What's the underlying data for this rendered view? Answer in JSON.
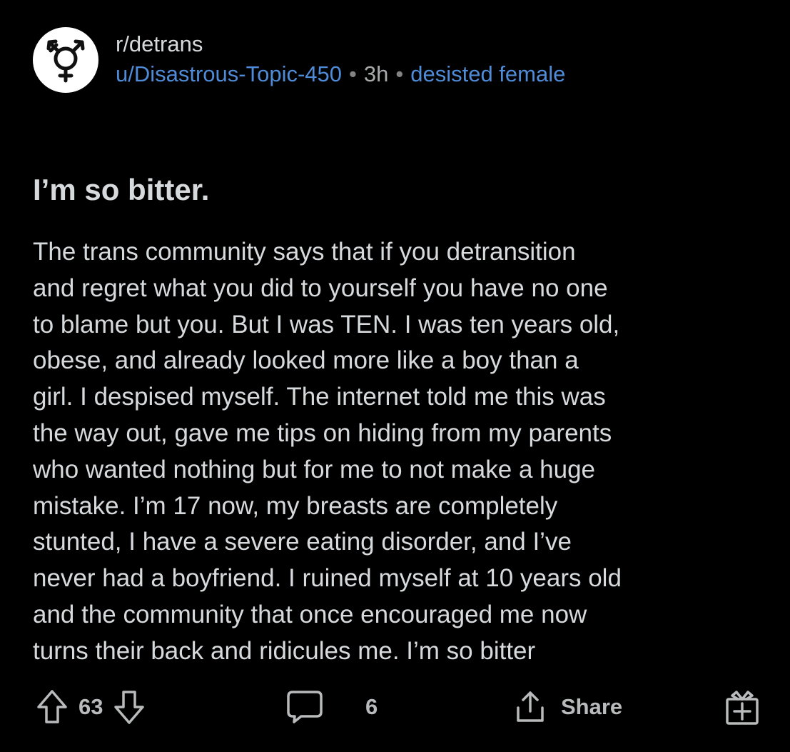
{
  "header": {
    "subreddit": "r/detrans",
    "username": "u/Disastrous-Topic-450",
    "separator": "•",
    "time": "3h",
    "flair": "desisted female",
    "avatar_icon": "transgender-symbol-icon"
  },
  "post": {
    "title": "I’m so bitter.",
    "body": "The trans community says that if you detransition\nand regret what you did to yourself you have no one\nto blame but you. But I was TEN. I was ten years old,\nobese, and already looked more like a boy than a\ngirl. I despised myself. The internet told me this was\nthe way out, gave me tips on hiding from my parents\nwho wanted nothing but for me to not make a huge\nmistake. I’m 17 now, my breasts are completely\nstunted, I have a severe eating disorder, and I’ve\nnever had a boyfriend. I ruined myself at 10 years old\nand the community that once encouraged me now\nturns their back and ridicules me. I’m so bitter"
  },
  "actions": {
    "upvote_icon": "arrow-up-icon",
    "score": "63",
    "downvote_icon": "arrow-down-icon",
    "comment_icon": "comment-bubble-icon",
    "comments": "6",
    "share_icon": "share-icon",
    "share_label": "Share",
    "award_icon": "gift-icon"
  },
  "colors": {
    "background": "#000000",
    "text": "#d7dadc",
    "link": "#4f8bd6",
    "muted": "#818384"
  }
}
